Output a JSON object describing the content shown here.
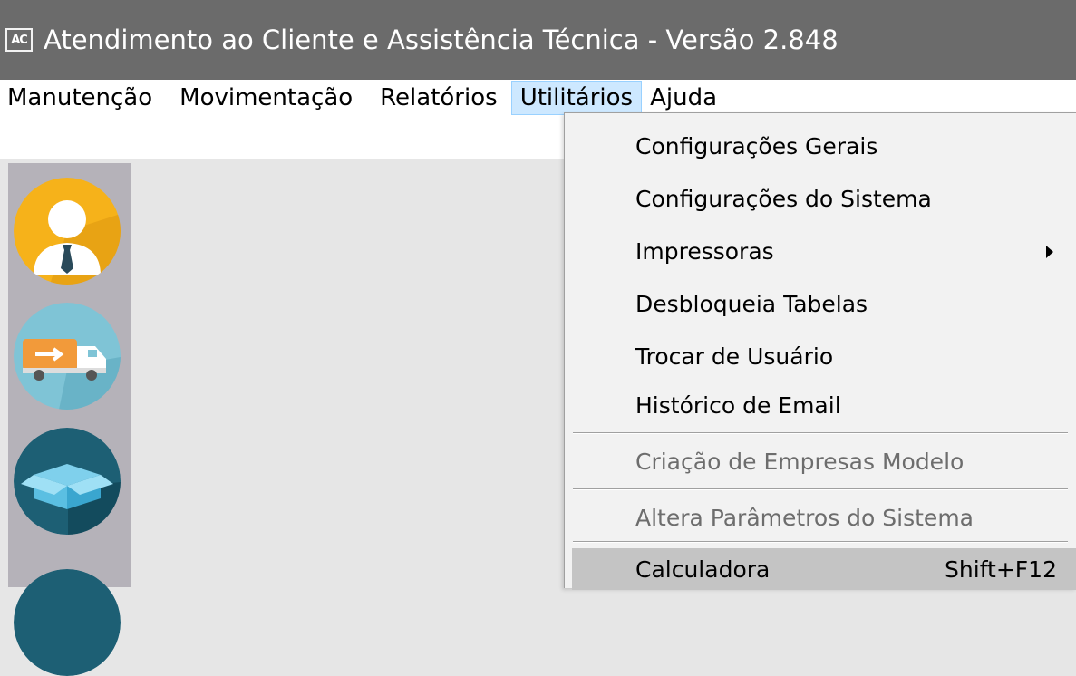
{
  "window": {
    "icon_text": "AC",
    "title": "Atendimento ao Cliente e Assistência Técnica - Versão 2.848"
  },
  "menubar": {
    "items": [
      "Manutenção",
      "Movimentação",
      "Relatórios",
      "Utilitários",
      "Ajuda"
    ],
    "active": "Utilitários"
  },
  "utilitarios_menu": {
    "items": [
      {
        "label": "Configurações Gerais",
        "enabled": true
      },
      {
        "label": "Configurações do Sistema",
        "enabled": true
      },
      {
        "label": "Impressoras",
        "enabled": true,
        "submenu": true
      },
      {
        "label": "Desbloqueia Tabelas",
        "enabled": true
      },
      {
        "label": "Trocar de Usuário",
        "enabled": true
      },
      {
        "label": "Histórico de Email",
        "enabled": true
      },
      {
        "label": "Criação de Empresas Modelo",
        "enabled": false
      },
      {
        "label": "Altera Parâmetros do Sistema",
        "enabled": false
      },
      {
        "label": "Calculadora",
        "enabled": true,
        "shortcut": "Shift+F12",
        "highlighted": true
      }
    ]
  },
  "sidebar": {
    "buttons": [
      {
        "icon": "client-icon",
        "color": "#f6b21a"
      },
      {
        "icon": "delivery-truck-icon",
        "color": "#7fc4d6"
      },
      {
        "icon": "product-box-icon",
        "color": "#1d5f74"
      },
      {
        "icon": "partial-icon",
        "color": "#1d5f74"
      }
    ]
  },
  "colors": {
    "titlebar": "#6b6b6b",
    "menu_active_bg": "#cde8ff",
    "dropdown_bg": "#f2f2f2",
    "highlight_bg": "#c4c4c4"
  }
}
